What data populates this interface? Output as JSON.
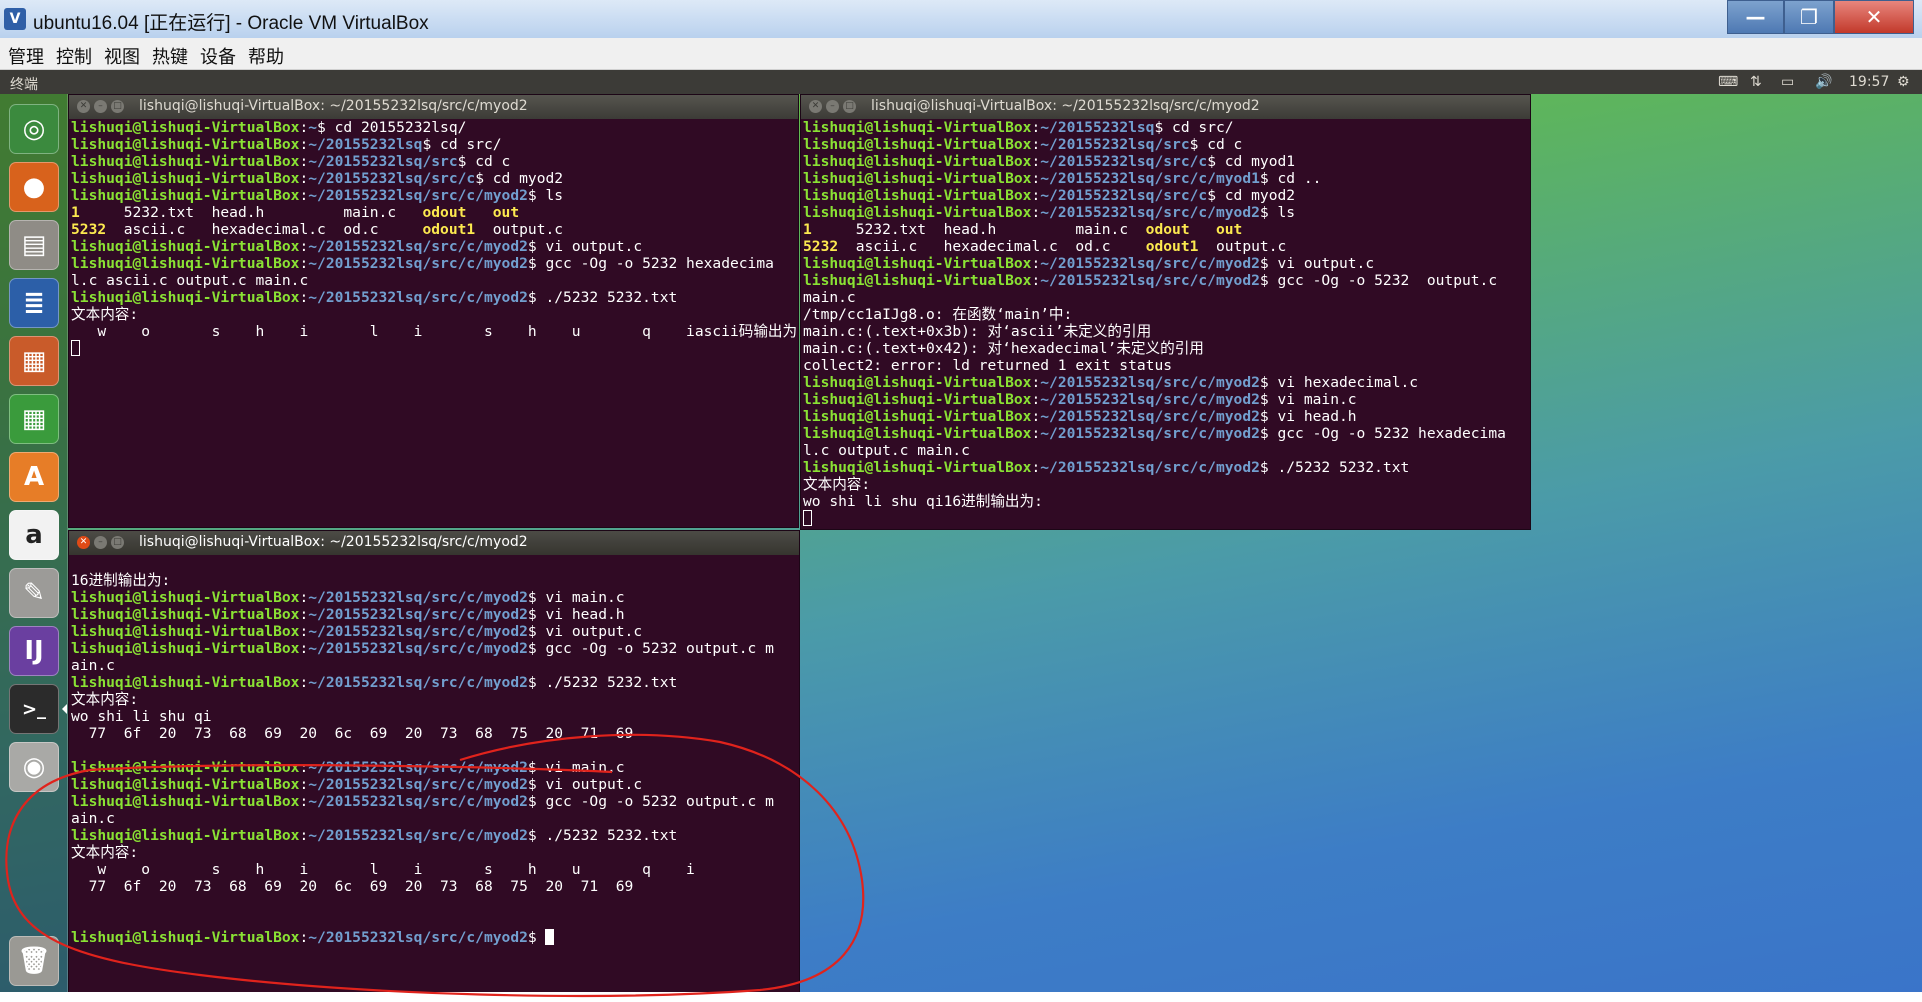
{
  "host": {
    "title": "ubuntu16.04 [正在运行] - Oracle VM VirtualBox",
    "menu": [
      "管理",
      "控制",
      "视图",
      "热键",
      "设备",
      "帮助"
    ],
    "buttons": {
      "minimize": "—",
      "maximize": "❐",
      "close": "✕"
    }
  },
  "topbar": {
    "app_name": "终端",
    "clock": "19:57"
  },
  "launcher": [
    "dash",
    "firefox",
    "files",
    "writer",
    "impress",
    "calc",
    "software-center",
    "amazon",
    "settings",
    "intellij",
    "terminal",
    "dvd",
    "trash"
  ],
  "terminals": [
    {
      "title": "lishuqi@lishuqi-VirtualBox: ~/20155232lsq/src/c/myod2",
      "lines": [
        [
          {
            "t": "lishuqi@lishuqi-VirtualBox",
            "c": "g"
          },
          {
            "t": ":"
          },
          {
            "t": "~",
            "c": "b"
          },
          {
            "t": "$ cd 20155232lsq/"
          }
        ],
        [
          {
            "t": "lishuqi@lishuqi-VirtualBox",
            "c": "g"
          },
          {
            "t": ":"
          },
          {
            "t": "~/20155232lsq",
            "c": "b"
          },
          {
            "t": "$ cd src/"
          }
        ],
        [
          {
            "t": "lishuqi@lishuqi-VirtualBox",
            "c": "g"
          },
          {
            "t": ":"
          },
          {
            "t": "~/20155232lsq/src",
            "c": "b"
          },
          {
            "t": "$ cd c"
          }
        ],
        [
          {
            "t": "lishuqi@lishuqi-VirtualBox",
            "c": "g"
          },
          {
            "t": ":"
          },
          {
            "t": "~/20155232lsq/src/c",
            "c": "b"
          },
          {
            "t": "$ cd myod2"
          }
        ],
        [
          {
            "t": "lishuqi@lishuqi-VirtualBox",
            "c": "g"
          },
          {
            "t": ":"
          },
          {
            "t": "~/20155232lsq/src/c/myod2",
            "c": "b"
          },
          {
            "t": "$ ls"
          }
        ],
        [
          {
            "t": "1",
            "c": "y"
          },
          {
            "t": "     5232.txt  head.h         main.c   "
          },
          {
            "t": "odout",
            "c": "y"
          },
          {
            "t": "   "
          },
          {
            "t": "out",
            "c": "y"
          }
        ],
        [
          {
            "t": "5232",
            "c": "y"
          },
          {
            "t": "  ascii.c   hexadecimal.c  od.c     "
          },
          {
            "t": "odout1",
            "c": "y"
          },
          {
            "t": "  output.c"
          }
        ],
        [
          {
            "t": "lishuqi@lishuqi-VirtualBox",
            "c": "g"
          },
          {
            "t": ":"
          },
          {
            "t": "~/20155232lsq/src/c/myod2",
            "c": "b"
          },
          {
            "t": "$ vi output.c"
          }
        ],
        [
          {
            "t": "lishuqi@lishuqi-VirtualBox",
            "c": "g"
          },
          {
            "t": ":"
          },
          {
            "t": "~/20155232lsq/src/c/myod2",
            "c": "b"
          },
          {
            "t": "$ gcc -Og -o 5232 hexadecima"
          }
        ],
        [
          {
            "t": "l.c ascii.c output.c main.c"
          }
        ],
        [
          {
            "t": "lishuqi@lishuqi-VirtualBox",
            "c": "g"
          },
          {
            "t": ":"
          },
          {
            "t": "~/20155232lsq/src/c/myod2",
            "c": "b"
          },
          {
            "t": "$ ./5232 5232.txt"
          }
        ],
        [
          {
            "t": "文本内容:"
          }
        ],
        [
          {
            "t": "   w    o       s    h    i       l    i       s    h    u       q    iascii码输出为:"
          }
        ],
        [
          {
            "t": "",
            "cursor": "outline"
          }
        ]
      ]
    },
    {
      "title": "lishuqi@lishuqi-VirtualBox: ~/20155232lsq/src/c/myod2",
      "lines": [
        [
          {
            "t": "lishuqi@lishuqi-VirtualBox",
            "c": "g"
          },
          {
            "t": ":"
          },
          {
            "t": "~/20155232lsq",
            "c": "b"
          },
          {
            "t": "$ cd src/"
          }
        ],
        [
          {
            "t": "lishuqi@lishuqi-VirtualBox",
            "c": "g"
          },
          {
            "t": ":"
          },
          {
            "t": "~/20155232lsq/src",
            "c": "b"
          },
          {
            "t": "$ cd c"
          }
        ],
        [
          {
            "t": "lishuqi@lishuqi-VirtualBox",
            "c": "g"
          },
          {
            "t": ":"
          },
          {
            "t": "~/20155232lsq/src/c",
            "c": "b"
          },
          {
            "t": "$ cd myod1"
          }
        ],
        [
          {
            "t": "lishuqi@lishuqi-VirtualBox",
            "c": "g"
          },
          {
            "t": ":"
          },
          {
            "t": "~/20155232lsq/src/c/myod1",
            "c": "b"
          },
          {
            "t": "$ cd .."
          }
        ],
        [
          {
            "t": "lishuqi@lishuqi-VirtualBox",
            "c": "g"
          },
          {
            "t": ":"
          },
          {
            "t": "~/20155232lsq/src/c",
            "c": "b"
          },
          {
            "t": "$ cd myod2"
          }
        ],
        [
          {
            "t": "lishuqi@lishuqi-VirtualBox",
            "c": "g"
          },
          {
            "t": ":"
          },
          {
            "t": "~/20155232lsq/src/c/myod2",
            "c": "b"
          },
          {
            "t": "$ ls"
          }
        ],
        [
          {
            "t": "1",
            "c": "y"
          },
          {
            "t": "     5232.txt  head.h         main.c  "
          },
          {
            "t": "odout",
            "c": "y"
          },
          {
            "t": "   "
          },
          {
            "t": "out",
            "c": "y"
          }
        ],
        [
          {
            "t": "5232",
            "c": "y"
          },
          {
            "t": "  ascii.c   hexadecimal.c  od.c    "
          },
          {
            "t": "odout1",
            "c": "y"
          },
          {
            "t": "  output.c"
          }
        ],
        [
          {
            "t": "lishuqi@lishuqi-VirtualBox",
            "c": "g"
          },
          {
            "t": ":"
          },
          {
            "t": "~/20155232lsq/src/c/myod2",
            "c": "b"
          },
          {
            "t": "$ vi output.c"
          }
        ],
        [
          {
            "t": "lishuqi@lishuqi-VirtualBox",
            "c": "g"
          },
          {
            "t": ":"
          },
          {
            "t": "~/20155232lsq/src/c/myod2",
            "c": "b"
          },
          {
            "t": "$ gcc -Og -o 5232  output.c"
          }
        ],
        [
          {
            "t": "main.c"
          }
        ],
        [
          {
            "t": "/tmp/cc1aIJg8.o: 在函数‘main’中:"
          }
        ],
        [
          {
            "t": "main.c:(.text+0x3b): 对‘ascii’未定义的引用"
          }
        ],
        [
          {
            "t": "main.c:(.text+0x42): 对‘hexadecimal’未定义的引用"
          }
        ],
        [
          {
            "t": "collect2: error: ld returned 1 exit status"
          }
        ],
        [
          {
            "t": "lishuqi@lishuqi-VirtualBox",
            "c": "g"
          },
          {
            "t": ":"
          },
          {
            "t": "~/20155232lsq/src/c/myod2",
            "c": "b"
          },
          {
            "t": "$ vi hexadecimal.c"
          }
        ],
        [
          {
            "t": "lishuqi@lishuqi-VirtualBox",
            "c": "g"
          },
          {
            "t": ":"
          },
          {
            "t": "~/20155232lsq/src/c/myod2",
            "c": "b"
          },
          {
            "t": "$ vi main.c"
          }
        ],
        [
          {
            "t": "lishuqi@lishuqi-VirtualBox",
            "c": "g"
          },
          {
            "t": ":"
          },
          {
            "t": "~/20155232lsq/src/c/myod2",
            "c": "b"
          },
          {
            "t": "$ vi head.h"
          }
        ],
        [
          {
            "t": "lishuqi@lishuqi-VirtualBox",
            "c": "g"
          },
          {
            "t": ":"
          },
          {
            "t": "~/20155232lsq/src/c/myod2",
            "c": "b"
          },
          {
            "t": "$ gcc -Og -o 5232 hexadecima"
          }
        ],
        [
          {
            "t": "l.c output.c main.c"
          }
        ],
        [
          {
            "t": "lishuqi@lishuqi-VirtualBox",
            "c": "g"
          },
          {
            "t": ":"
          },
          {
            "t": "~/20155232lsq/src/c/myod2",
            "c": "b"
          },
          {
            "t": "$ ./5232 5232.txt"
          }
        ],
        [
          {
            "t": "文本内容:"
          }
        ],
        [
          {
            "t": "wo shi li shu qi16进制输出为:"
          }
        ],
        [
          {
            "t": "",
            "cursor": "outline"
          }
        ]
      ]
    },
    {
      "title": "lishuqi@lishuqi-VirtualBox: ~/20155232lsq/src/c/myod2",
      "lines": [
        [
          {
            "t": ""
          }
        ],
        [
          {
            "t": "16进制输出为:"
          }
        ],
        [
          {
            "t": "lishuqi@lishuqi-VirtualBox",
            "c": "g"
          },
          {
            "t": ":"
          },
          {
            "t": "~/20155232lsq/src/c/myod2",
            "c": "b"
          },
          {
            "t": "$ vi main.c"
          }
        ],
        [
          {
            "t": "lishuqi@lishuqi-VirtualBox",
            "c": "g"
          },
          {
            "t": ":"
          },
          {
            "t": "~/20155232lsq/src/c/myod2",
            "c": "b"
          },
          {
            "t": "$ vi head.h"
          }
        ],
        [
          {
            "t": "lishuqi@lishuqi-VirtualBox",
            "c": "g"
          },
          {
            "t": ":"
          },
          {
            "t": "~/20155232lsq/src/c/myod2",
            "c": "b"
          },
          {
            "t": "$ vi output.c"
          }
        ],
        [
          {
            "t": "lishuqi@lishuqi-VirtualBox",
            "c": "g"
          },
          {
            "t": ":"
          },
          {
            "t": "~/20155232lsq/src/c/myod2",
            "c": "b"
          },
          {
            "t": "$ gcc -Og -o 5232 output.c m"
          }
        ],
        [
          {
            "t": "ain.c"
          }
        ],
        [
          {
            "t": "lishuqi@lishuqi-VirtualBox",
            "c": "g"
          },
          {
            "t": ":"
          },
          {
            "t": "~/20155232lsq/src/c/myod2",
            "c": "b"
          },
          {
            "t": "$ ./5232 5232.txt"
          }
        ],
        [
          {
            "t": "文本内容:"
          }
        ],
        [
          {
            "t": "wo shi li shu qi"
          }
        ],
        [
          {
            "t": "  77  6f  20  73  68  69  20  6c  69  20  73  68  75  20  71  69"
          }
        ],
        [
          {
            "t": ""
          }
        ],
        [
          {
            "t": "lishuqi@lishuqi-VirtualBox",
            "c": "g"
          },
          {
            "t": ":"
          },
          {
            "t": "~/20155232lsq/src/c/myod2",
            "c": "b"
          },
          {
            "t": "$ vi main.c"
          }
        ],
        [
          {
            "t": "lishuqi@lishuqi-VirtualBox",
            "c": "g"
          },
          {
            "t": ":"
          },
          {
            "t": "~/20155232lsq/src/c/myod2",
            "c": "b"
          },
          {
            "t": "$ vi output.c"
          }
        ],
        [
          {
            "t": "lishuqi@lishuqi-VirtualBox",
            "c": "g"
          },
          {
            "t": ":"
          },
          {
            "t": "~/20155232lsq/src/c/myod2",
            "c": "b"
          },
          {
            "t": "$ gcc -Og -o 5232 output.c m"
          }
        ],
        [
          {
            "t": "ain.c"
          }
        ],
        [
          {
            "t": "lishuqi@lishuqi-VirtualBox",
            "c": "g"
          },
          {
            "t": ":"
          },
          {
            "t": "~/20155232lsq/src/c/myod2",
            "c": "b"
          },
          {
            "t": "$ ./5232 5232.txt"
          }
        ],
        [
          {
            "t": "文本内容:"
          }
        ],
        [
          {
            "t": "   w    o       s    h    i       l    i       s    h    u       q    i"
          }
        ],
        [
          {
            "t": "  77  6f  20  73  68  69  20  6c  69  20  73  68  75  20  71  69"
          }
        ],
        [
          {
            "t": ""
          }
        ],
        [
          {
            "t": ""
          }
        ],
        [
          {
            "t": "lishuqi@lishuqi-VirtualBox",
            "c": "g"
          },
          {
            "t": ":"
          },
          {
            "t": "~/20155232lsq/src/c/myod2",
            "c": "b"
          },
          {
            "t": "$ "
          },
          {
            "t": "",
            "cursor": "block"
          }
        ]
      ]
    }
  ],
  "colors": {
    "prompt_user": "#8ae234",
    "prompt_path": "#729fcf",
    "exec_file": "#fce94f",
    "terminal_bg": "#300a24",
    "annotation": "#e0231c"
  }
}
